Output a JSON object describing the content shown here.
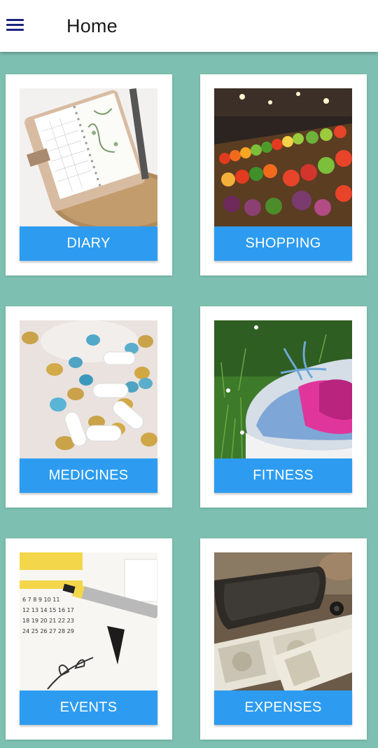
{
  "header": {
    "menu_icon": "hamburger-menu-icon",
    "title": "Home"
  },
  "colors": {
    "background": "#7dbfb0",
    "button": "#2d9cf0",
    "menu_icon": "#1a237e"
  },
  "cards": [
    {
      "label": "DIARY",
      "image": "planner-notebook-photo"
    },
    {
      "label": "SHOPPING",
      "image": "vegetable-market-photo"
    },
    {
      "label": "MEDICINES",
      "image": "pills-capsules-photo"
    },
    {
      "label": "FITNESS",
      "image": "running-shoe-photo"
    },
    {
      "label": "EVENTS",
      "image": "calendar-pen-photo"
    },
    {
      "label": "EXPENSES",
      "image": "wallet-money-photo"
    }
  ]
}
